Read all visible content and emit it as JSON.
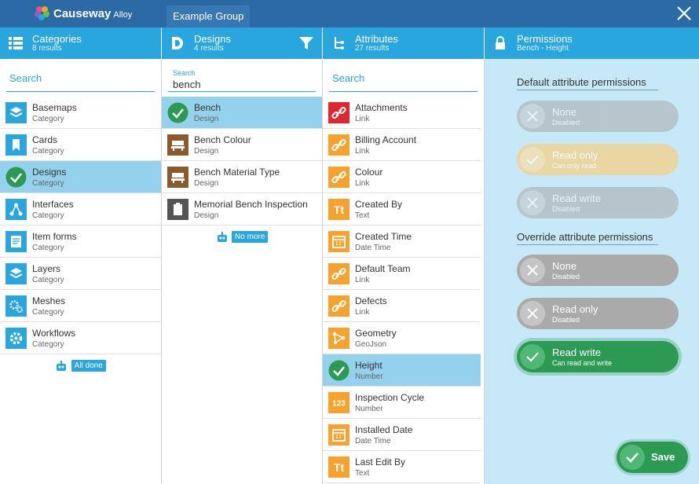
{
  "app": {
    "brand": "Causeway",
    "brand_sub": "Alloy",
    "group_tab": "Example Group"
  },
  "colors": {
    "topbar": "#2b6aa5",
    "accent": "#29a6dd",
    "selected": "#93d1ec",
    "orange": "#f5a32e",
    "red": "#e0262e",
    "green": "#2c9a52",
    "yellow": "#f1d28f",
    "gray": "#aaaaaa"
  },
  "categories": {
    "title": "Categories",
    "sub": "8 results",
    "search_placeholder": "Search",
    "footer": "All done",
    "items": [
      {
        "name": "Basemaps",
        "type": "Category",
        "icon": "layers-icon"
      },
      {
        "name": "Cards",
        "type": "Category",
        "icon": "bookmark-icon"
      },
      {
        "name": "Designs",
        "type": "Category",
        "icon": "check-icon",
        "selected": true
      },
      {
        "name": "Interfaces",
        "type": "Category",
        "icon": "network-icon"
      },
      {
        "name": "Item forms",
        "type": "Category",
        "icon": "form-icon"
      },
      {
        "name": "Layers",
        "type": "Category",
        "icon": "layers-icon"
      },
      {
        "name": "Meshes",
        "type": "Category",
        "icon": "cogs-icon"
      },
      {
        "name": "Workflows",
        "type": "Category",
        "icon": "gear-icon"
      }
    ]
  },
  "designs": {
    "title": "Designs",
    "sub": "4 results",
    "search_label": "Search",
    "search_value": "bench",
    "footer": "No more",
    "items": [
      {
        "name": "Bench",
        "type": "Design",
        "icon": "check-icon",
        "selected": true
      },
      {
        "name": "Bench Colour",
        "type": "Design",
        "icon": "bench-icon"
      },
      {
        "name": "Bench Material Type",
        "type": "Design",
        "icon": "bench-icon"
      },
      {
        "name": "Memorial Bench Inspection",
        "type": "Design",
        "icon": "clipboard-icon"
      }
    ]
  },
  "attributes": {
    "title": "Attributes",
    "sub": "27 results",
    "search_placeholder": "Search",
    "items": [
      {
        "name": "Attachments",
        "type": "Link",
        "icon": "link-icon"
      },
      {
        "name": "Billing Account",
        "type": "Link",
        "icon": "link-icon"
      },
      {
        "name": "Colour",
        "type": "Link",
        "icon": "link-icon"
      },
      {
        "name": "Created By",
        "type": "Text",
        "icon": "text-icon"
      },
      {
        "name": "Created Time",
        "type": "Date Time",
        "icon": "calendar-icon"
      },
      {
        "name": "Default Team",
        "type": "Link",
        "icon": "link-icon"
      },
      {
        "name": "Defects",
        "type": "Link",
        "icon": "link-icon"
      },
      {
        "name": "Geometry",
        "type": "GeoJson",
        "icon": "geometry-icon"
      },
      {
        "name": "Height",
        "type": "Number",
        "icon": "check-icon",
        "selected": true
      },
      {
        "name": "Inspection Cycle",
        "type": "Number",
        "icon": "number-icon"
      },
      {
        "name": "Installed Date",
        "type": "Date Time",
        "icon": "calendar-icon"
      },
      {
        "name": "Last Edit By",
        "type": "Text",
        "icon": "text-icon"
      }
    ]
  },
  "permissions": {
    "title": "Permissions",
    "sub": "Bench - Height",
    "default_heading": "Default attribute permissions",
    "override_heading": "Override attribute permissions",
    "default": [
      {
        "label": "None",
        "sub": "Disabled",
        "state": "disabled"
      },
      {
        "label": "Read only",
        "sub": "Can only read",
        "state": "active"
      },
      {
        "label": "Read write",
        "sub": "Disabled",
        "state": "disabled"
      }
    ],
    "override": [
      {
        "label": "None",
        "sub": "Disabled",
        "state": "off"
      },
      {
        "label": "Read only",
        "sub": "Disabled",
        "state": "off"
      },
      {
        "label": "Read write",
        "sub": "Can read and write",
        "state": "on"
      }
    ],
    "save_label": "Save"
  }
}
